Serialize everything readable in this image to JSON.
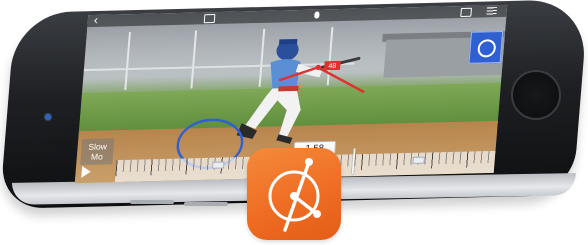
{
  "video_toolbar": {
    "back_icon": "chevron-left-icon",
    "mic_icon": "microphone-icon",
    "camera_icon": "camera-icon",
    "menu_icon": "hamburger-menu-icon"
  },
  "tools": {
    "circle_tool_icon": "circle-icon",
    "angle_marker_label": "48"
  },
  "playback": {
    "slow_mo_line1": "Slow",
    "slow_mo_line2": "Mo",
    "play_icon": "play-icon",
    "current_time": "1.58"
  },
  "colors": {
    "annotation_red": "#e0322c",
    "annotation_blue": "#2f5fd0",
    "app_orange": "#ee6b22"
  },
  "app": {
    "icon_name": "protractor-app-icon"
  }
}
